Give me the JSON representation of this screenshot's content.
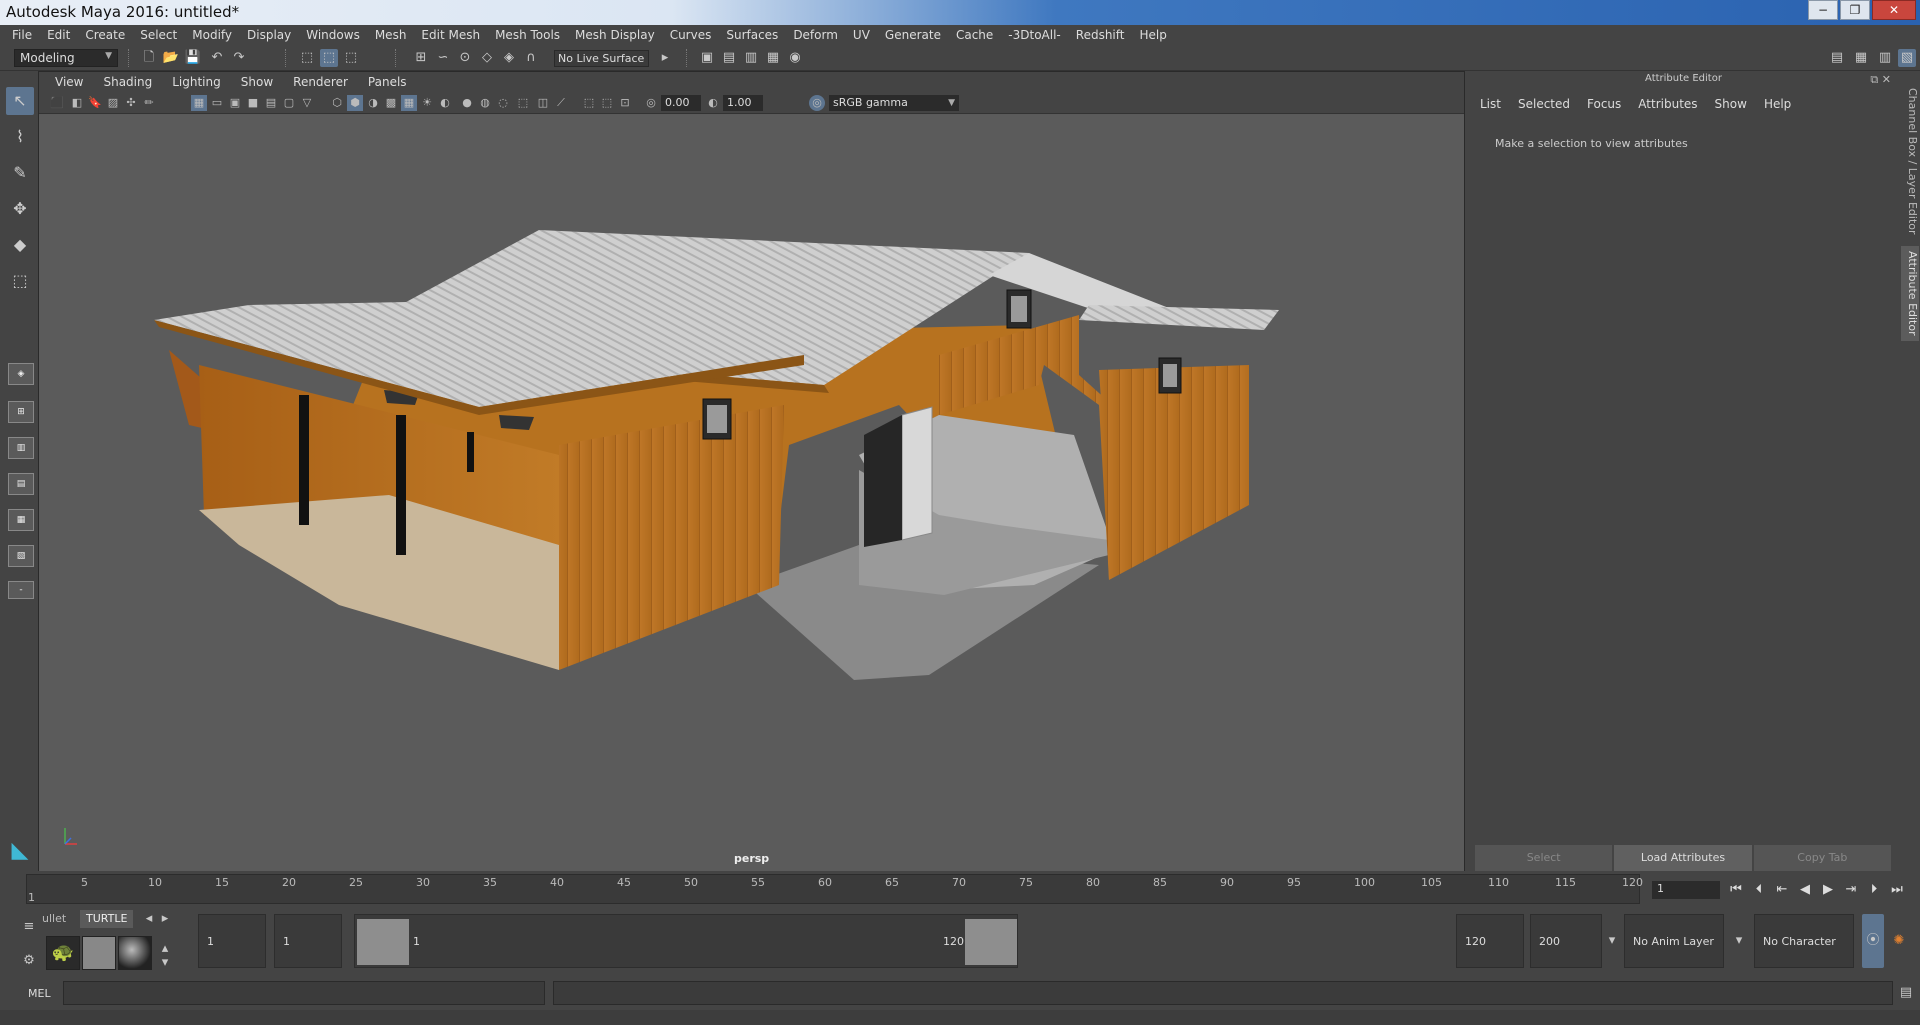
{
  "window": {
    "title": "Autodesk Maya 2016: untitled*",
    "minimize": "−",
    "restore": "❐",
    "close": "✕"
  },
  "menubar": [
    "File",
    "Edit",
    "Create",
    "Select",
    "Modify",
    "Display",
    "Windows",
    "Mesh",
    "Edit Mesh",
    "Mesh Tools",
    "Mesh Display",
    "Curves",
    "Surfaces",
    "Deform",
    "UV",
    "Generate",
    "Cache",
    "-3DtoAll-",
    "Redshift",
    "Help"
  ],
  "shelf": {
    "mode": "Modeling",
    "live_surface": "No Live Surface"
  },
  "viewport": {
    "menu": [
      "View",
      "Shading",
      "Lighting",
      "Show",
      "Renderer",
      "Panels"
    ],
    "exposure": "0.00",
    "gamma": "1.00",
    "colorspace": "sRGB gamma",
    "camera": "persp"
  },
  "attribute_editor": {
    "title": "Attribute Editor",
    "menu": [
      "List",
      "Selected",
      "Focus",
      "Attributes",
      "Show",
      "Help"
    ],
    "message": "Make a selection to view attributes",
    "buttons": [
      "Select",
      "Load Attributes",
      "Copy Tab"
    ]
  },
  "side_tabs": [
    "Channel Box / Layer Editor",
    "Attribute Editor"
  ],
  "timeline": {
    "ticks": [
      "5",
      "10",
      "15",
      "20",
      "25",
      "30",
      "35",
      "40",
      "45",
      "50",
      "55",
      "60",
      "65",
      "70",
      "75",
      "80",
      "85",
      "90",
      "95",
      "100",
      "105",
      "110",
      "115",
      "120"
    ],
    "start_tick": "1",
    "current_frame": "1"
  },
  "range": {
    "shelf_tabs": [
      "ullet",
      "TURTLE"
    ],
    "start_frame": "1",
    "playback_start": "1",
    "slider_start": "1",
    "slider_end": "120",
    "playback_end": "120",
    "end_frame": "200",
    "anim_layer": "No Anim Layer",
    "character_set": "No Character Set"
  },
  "mel": {
    "label": "MEL"
  },
  "colors": {
    "accent": "#5d7590",
    "maya_teal": "#3fb8d4",
    "viewport_bg": "#5b5b5b",
    "wood": "#b8741f",
    "roof": "#c8c8c8"
  },
  "icons": {
    "select": "select-arrow-icon",
    "lasso": "lasso-icon",
    "paint": "paint-select-icon",
    "move": "move-icon",
    "rotate": "rotate-icon",
    "scale": "scale-icon"
  }
}
